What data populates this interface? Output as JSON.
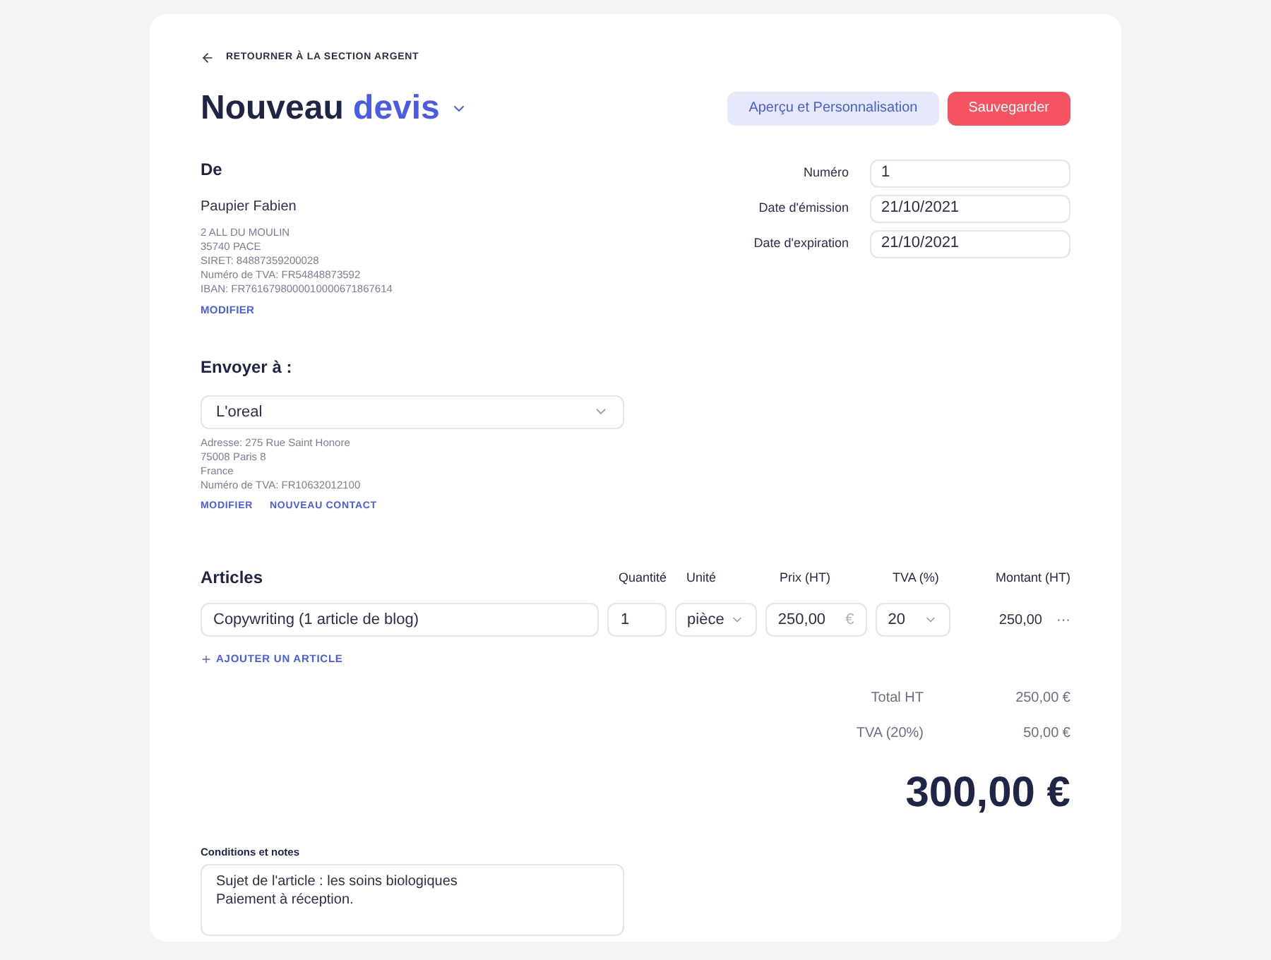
{
  "back_link": "RETOURNER À LA SECTION ARGENT",
  "title": {
    "word": "Nouveau",
    "doc_type": "devis"
  },
  "buttons": [
    {
      "label": "Aperçu et Personnalisation",
      "kind": "secondary"
    },
    {
      "label": "Sauvegarder",
      "kind": "primary"
    }
  ],
  "sender": {
    "heading": "De",
    "name": "Paupier Fabien",
    "lines": [
      "2 ALL DU MOULIN",
      "35740 PACE",
      "SIRET: 84887359200028",
      "Numéro de TVA: FR54848873592",
      "IBAN: FR7616798000010000671867614"
    ],
    "links": [
      "MODIFIER"
    ]
  },
  "meta_fields": [
    {
      "label": "Numéro",
      "value": "1"
    },
    {
      "label": "Date d'émission",
      "value": "21/10/2021"
    },
    {
      "label": "Date d'expiration",
      "value": "21/10/2021"
    }
  ],
  "recipient": {
    "heading": "Envoyer à :",
    "selected": "L'oreal",
    "lines": [
      "Adresse: 275 Rue Saint Honore",
      "75008 Paris 8",
      "France",
      "Numéro de TVA: FR10632012100"
    ],
    "links": [
      "MODIFIER",
      "NOUVEAU CONTACT"
    ]
  },
  "articles": {
    "columns": [
      "Articles",
      "Quantité",
      "Unité",
      "Prix (HT)",
      "TVA (%)",
      "Montant (HT)"
    ],
    "rows": [
      {
        "description": "Copywriting (1 article de blog)",
        "quantity": "1",
        "unit": "pièce",
        "price": "250,00",
        "currency": "€",
        "vat": "20",
        "amount": "250,00",
        "more": "···"
      }
    ],
    "add_link": "AJOUTER UN ARTICLE"
  },
  "totals": [
    {
      "label": "Total HT",
      "value": "250,00 €"
    },
    {
      "label": "TVA (20%)",
      "value": "50,00 €"
    }
  ],
  "grand_total": "300,00 €",
  "notes": {
    "label": "Conditions et notes",
    "lines": [
      "Sujet de l'article : les soins biologiques",
      "Paiement à réception."
    ]
  }
}
